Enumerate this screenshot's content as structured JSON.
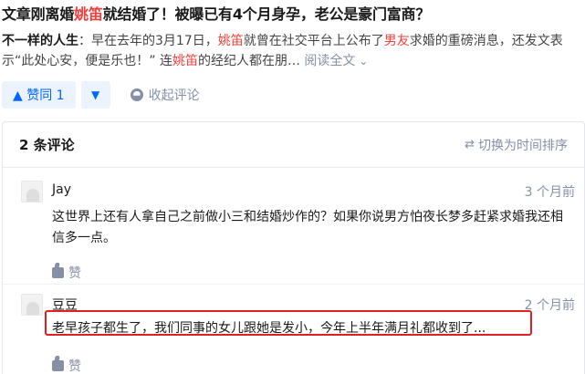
{
  "article": {
    "title_parts": [
      "文章刚离婚",
      "姚笛",
      "就结婚了！被曝已有4个月身孕，老公是豪门富商？"
    ],
    "excerpt": {
      "author": "不一样的人生",
      "sep": "：",
      "text1": "早在去年的3月17日，",
      "hl1": "姚笛",
      "text2": "就曾在社交平台上公布了",
      "hl2": "男友",
      "text3": "求婚的重磅消息，还发文表示“此处心安，便是乐也！” 连",
      "hl3": "姚笛",
      "text4": "的经纪人都在朋… ",
      "more": "阅读全文"
    }
  },
  "actions": {
    "vote_up": "▲ 赞同 1",
    "vote_down": "▼",
    "collapse": "收起评论"
  },
  "comments": {
    "count_label": "2 条评论",
    "sort_label": "切换为时间排序",
    "items": [
      {
        "user": "Jay",
        "time": "3 个月前",
        "text": "这世界上还有人拿自己之前做小三和结婚炒作的？如果你说男方怕夜长梦多赶紧求婚我还相信多一点。",
        "like": "赞"
      },
      {
        "user": "豆豆",
        "time": "2 个月前",
        "text": "老早孩子都生了，我们同事的女儿跟她是发小，今年上半年满月礼都收到了...",
        "like": "赞"
      }
    ]
  },
  "colors": {
    "accent": "#0066ff",
    "highlight": "#f1403c",
    "muted": "#8590a6",
    "annotation": "#e02020"
  }
}
